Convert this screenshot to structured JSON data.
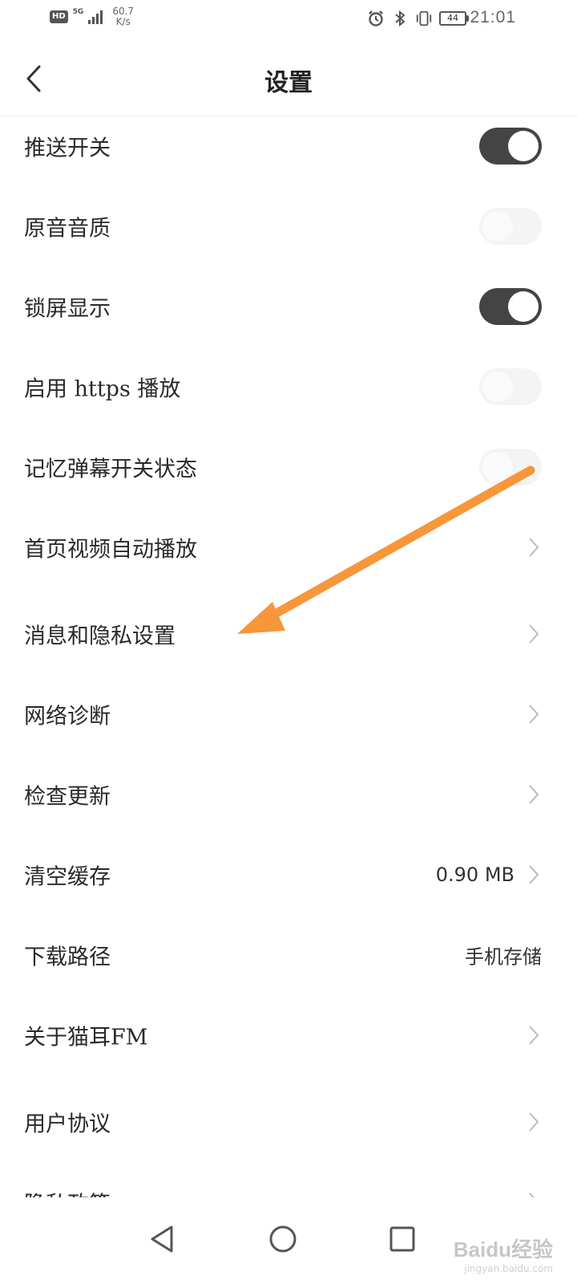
{
  "status_bar": {
    "hd": "HD",
    "network": "5G",
    "speed_value": "60.7",
    "speed_unit": "K/s",
    "battery": "44",
    "time": "21:01"
  },
  "header": {
    "title": "设置"
  },
  "settings": {
    "push_switch": "推送开关",
    "original_audio": "原音音质",
    "lock_screen": "锁屏显示",
    "https_play": "启用 https 播放",
    "danmaku_memory": "记忆弹幕开关状态",
    "autoplay": "首页视频自动播放",
    "message_privacy": "消息和隐私设置",
    "network_diagnose": "网络诊断",
    "check_update": "检查更新",
    "clear_cache": "清空缓存",
    "clear_cache_value": "0.90 MB",
    "download_path": "下载路径",
    "download_path_value": "手机存储",
    "about": "关于猫耳FM",
    "user_agreement": "用户协议",
    "privacy_policy": "隐私政策"
  },
  "toggles": {
    "push_switch": true,
    "original_audio": false,
    "lock_screen": true,
    "https_play": false,
    "danmaku_memory": false
  },
  "annotation": {
    "color": "#F7963B"
  },
  "watermark": {
    "logo": "Baidu经验",
    "url": "jingyan.baidu.com"
  }
}
